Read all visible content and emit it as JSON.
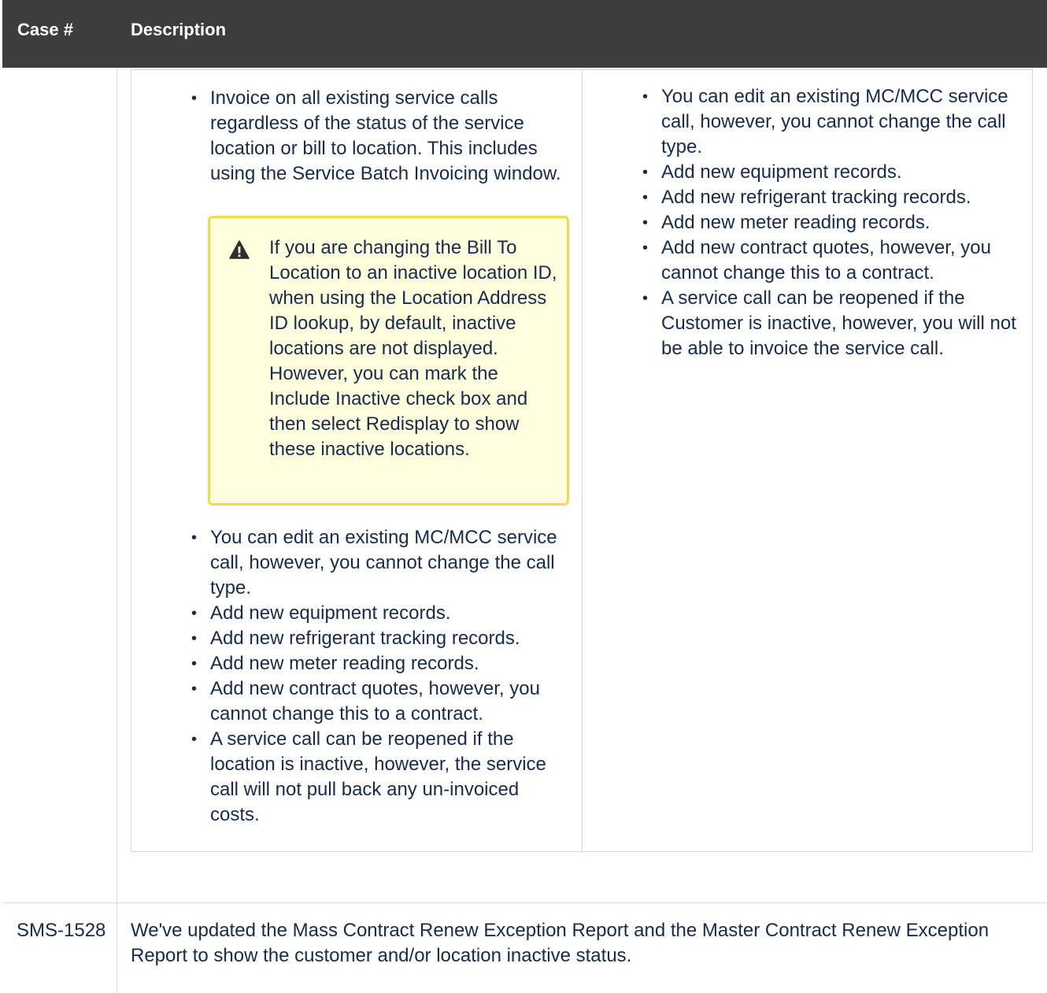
{
  "header": {
    "case_label": "Case #",
    "description_label": "Description"
  },
  "row1": {
    "left": {
      "intro_items": [
        "Invoice on all existing service calls regardless of the status of the service location or bill to location. This includes using the Service Batch Invoicing window."
      ],
      "warning": {
        "icon": "warning-triangle-icon",
        "text": "If you are changing the Bill To Location to an inactive location ID, when using the Location Address ID lookup, by default, inactive locations are not displayed. However, you can mark the Include Inactive check box and then select Redisplay to show these inactive locations."
      },
      "items": [
        "You can edit an existing MC/MCC service call, however, you cannot change the call type.",
        "Add new equipment records.",
        "Add new refrigerant tracking records.",
        "Add new meter reading records.",
        "Add new contract quotes, however, you cannot change this to a contract.",
        "A service call can be reopened if the location is inactive, however, the service call will not pull back any un-invoiced costs."
      ]
    },
    "right": {
      "items": [
        "You can edit an existing MC/MCC service call, however, you cannot change the call type.",
        "Add new equipment records.",
        "Add new refrigerant tracking records.",
        "Add new meter reading records.",
        "Add new contract quotes, however, you cannot change this to a contract.",
        "A service call can be reopened if the Customer is inactive, however, you will not be able to invoice the service call."
      ]
    }
  },
  "row2": {
    "case": "SMS-1528",
    "description": "We've updated the Mass Contract Renew Exception Report and the Master Contract Renew Exception Report to show the customer and/or location inactive status."
  },
  "colors": {
    "header_bg": "#3d3d3d",
    "warning_bg": "#ffffdd",
    "warning_border": "#f0d94a",
    "text": "#172b4d"
  }
}
